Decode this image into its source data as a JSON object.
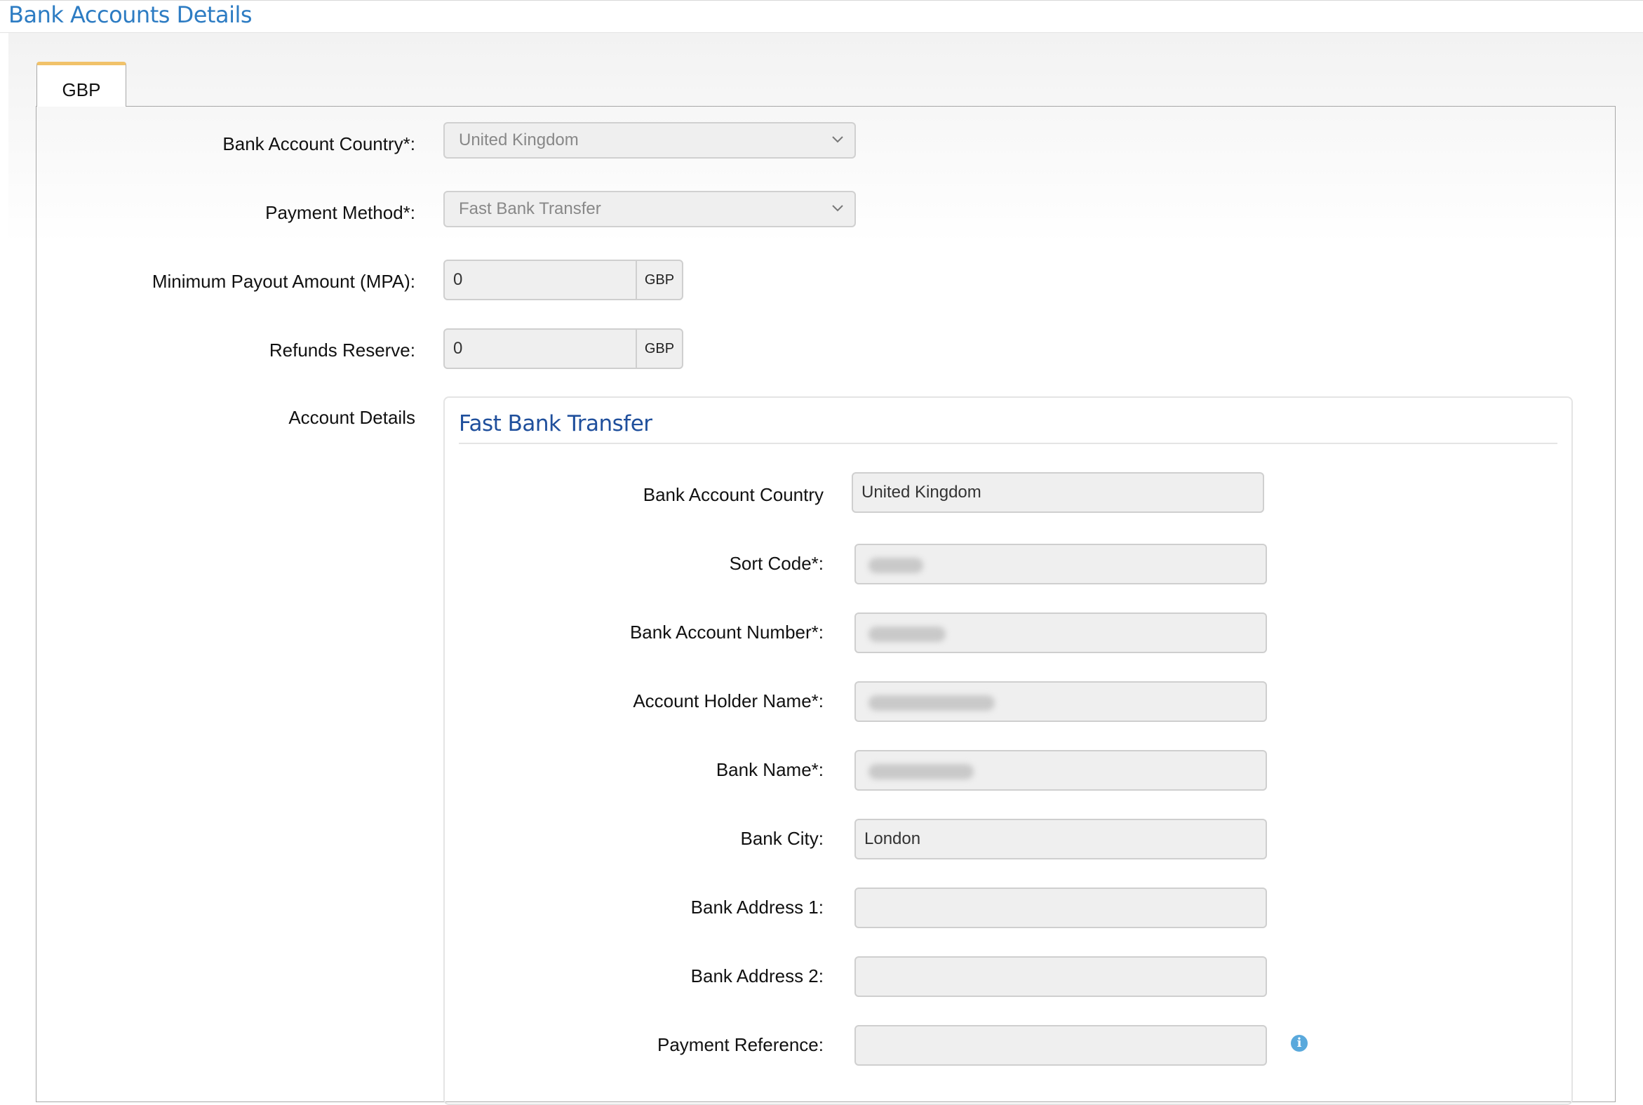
{
  "page": {
    "title": "Bank Accounts Details"
  },
  "tabs": [
    {
      "label": "GBP",
      "active": true
    }
  ],
  "settings": {
    "bank_account_country": {
      "label": "Bank Account Country*:",
      "value": "United Kingdom"
    },
    "payment_method": {
      "label": "Payment Method*:",
      "value": "Fast Bank Transfer"
    },
    "minimum_payout": {
      "label": "Minimum Payout Amount (MPA):",
      "value": "0",
      "currency": "GBP"
    },
    "refunds_reserve": {
      "label": "Refunds Reserve:",
      "value": "0",
      "currency": "GBP"
    },
    "account_details_label": "Account Details"
  },
  "account_details": {
    "title": "Fast Bank Transfer",
    "fields": {
      "bank_account_country": {
        "label": "Bank Account Country",
        "value": "United Kingdom"
      },
      "sort_code": {
        "label": "Sort Code*:",
        "value": ""
      },
      "bank_account_number": {
        "label": "Bank Account Number*:",
        "value": ""
      },
      "account_holder_name": {
        "label": "Account Holder Name*:",
        "value": ""
      },
      "bank_name": {
        "label": "Bank Name*:",
        "value": ""
      },
      "bank_city": {
        "label": "Bank City:",
        "value": "London"
      },
      "bank_address_1": {
        "label": "Bank Address 1:",
        "value": ""
      },
      "bank_address_2": {
        "label": "Bank Address 2:",
        "value": ""
      },
      "payment_reference": {
        "label": "Payment Reference:",
        "value": ""
      }
    }
  },
  "colors": {
    "title": "#2d7cc3",
    "section_title": "#1f4f9c",
    "tab_accent": "#f1c26a",
    "info_icon": "#5aa9dc"
  },
  "icons": {
    "select_arrow": "chevron-down-icon",
    "info": "info-icon"
  }
}
